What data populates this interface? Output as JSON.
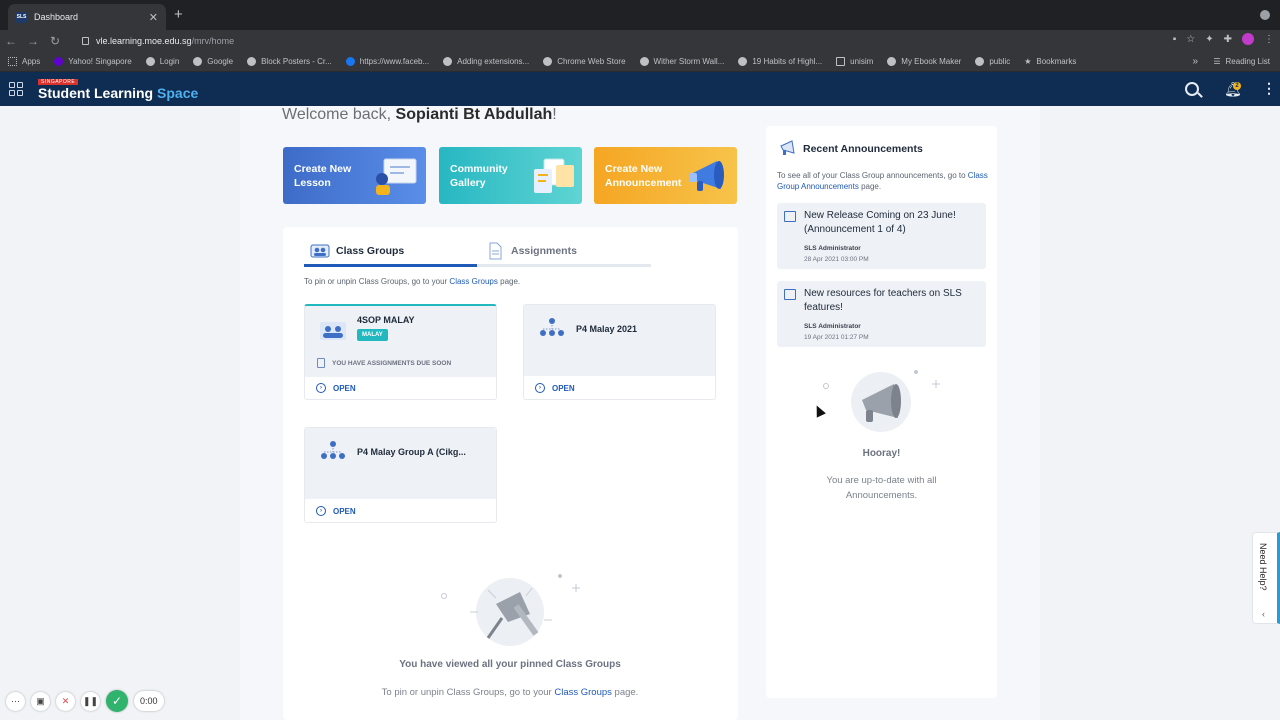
{
  "browser": {
    "tab_title": "Dashboard",
    "tab_favicon": "SLS",
    "new_tab": "+",
    "url_host": "vle.learning.moe.edu.sg",
    "url_path": "/mrv/home",
    "bookmarks": [
      {
        "label": "Apps",
        "icon": "apps"
      },
      {
        "label": "Yahoo! Singapore",
        "icon": "yahoo"
      },
      {
        "label": "Login",
        "icon": "globe"
      },
      {
        "label": "Google",
        "icon": "google"
      },
      {
        "label": "Block Posters - Cr...",
        "icon": "globe"
      },
      {
        "label": "https://www.faceb...",
        "icon": "fb"
      },
      {
        "label": "Adding extensions...",
        "icon": "globe"
      },
      {
        "label": "Chrome Web Store",
        "icon": "globe"
      },
      {
        "label": "Wither Storm Wall...",
        "icon": "google"
      },
      {
        "label": "19 Habits of Highl...",
        "icon": "globe"
      },
      {
        "label": "unisim",
        "icon": "folder"
      },
      {
        "label": "My Ebook Maker",
        "icon": "globe"
      },
      {
        "label": "public",
        "icon": "globe"
      },
      {
        "label": "Bookmarks",
        "icon": "star"
      }
    ],
    "bookmarks_more": "»",
    "reading_list": "Reading List"
  },
  "app": {
    "logo_tag": "SINGAPORE",
    "logo_word1": "Student Learning",
    "logo_word2": "Space",
    "notification_count": "2"
  },
  "welcome": {
    "prefix": "Welcome back, ",
    "name": "Sopianti Bt Abdullah",
    "suffix": "!"
  },
  "quick_actions": [
    {
      "label": "Create New Lesson",
      "color": "#3d6cc8"
    },
    {
      "label": "Community Gallery",
      "color": "#27b7c2"
    },
    {
      "label": "Create New Announcement",
      "color": "#f5a623"
    }
  ],
  "tabs": {
    "class_groups": "Class Groups",
    "assignments": "Assignments"
  },
  "pin_hint": {
    "before": "To pin or unpin Class Groups, go to your ",
    "link": "Class Groups",
    "after": " page."
  },
  "groups": [
    {
      "name": "4SOP MALAY",
      "badge": "MALAY",
      "note": "YOU HAVE ASSIGNMENTS DUE SOON",
      "open": "OPEN"
    },
    {
      "name": "P4 Malay 2021",
      "open": "OPEN"
    },
    {
      "name": "P4 Malay Group A (Cikg...",
      "open": "OPEN"
    }
  ],
  "empty_pinned": {
    "title": "You have viewed all your pinned Class Groups",
    "sub_before": "To pin or unpin Class Groups, go to your ",
    "sub_link": "Class Groups",
    "sub_after": " page."
  },
  "announcements": {
    "title": "Recent Announcements",
    "hint_before": "To see all of your Class Group announcements, go to ",
    "hint_link": "Class Group Announcements",
    "hint_after": " page.",
    "items": [
      {
        "title": "New Release Coming on 23 June! (Announcement 1 of 4)",
        "author": "SLS Administrator",
        "date": "28 Apr 2021 03:00 PM"
      },
      {
        "title": "New resources for teachers on SLS features!",
        "author": "SLS Administrator",
        "date": "19 Apr 2021 01:27 PM"
      }
    ],
    "empty_title": "Hooray!",
    "empty_sub": "You are up-to-date with all Announcements."
  },
  "need_help": "Need Help?",
  "recorder": {
    "time": "0:00"
  }
}
